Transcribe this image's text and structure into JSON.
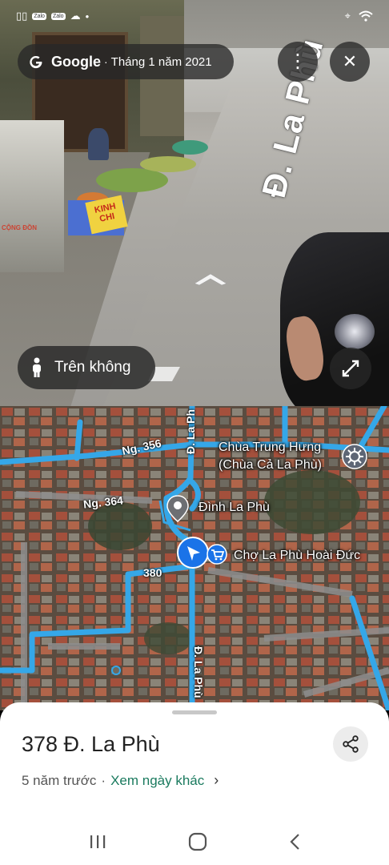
{
  "street_view": {
    "provider": "Google",
    "capture_date": "Tháng 1 năm 2021",
    "separator": "·",
    "road_name": "Đ. La Phù",
    "aerial_label": "Trên không",
    "stall_sign": "KINH CHI",
    "shop_sign": "CỘNG ĐỒN"
  },
  "status_bar": {
    "left_chips": [
      "Zalo",
      "Zalo"
    ]
  },
  "map": {
    "road_labels": {
      "ng356": "Ng. 356",
      "ng364": "Ng. 364",
      "road380": "380",
      "la_phu_top": "Đ. La Ph",
      "la_phu_bottom": "Đ. La Phù"
    },
    "places": {
      "temple_line1": "Chùa Trung Hưng",
      "temple_line2": "(Chùa Cả La Phù)",
      "communal_house": "Đình La Phù",
      "market": "Chợ La Phù Hoài Đức"
    }
  },
  "sheet": {
    "address": "378 Đ. La Phù",
    "age": "5 năm trước",
    "dot": "·",
    "other_dates_link": "Xem ngày khác"
  },
  "colors": {
    "route": "#35a7e8",
    "link": "#1a7a5e",
    "location": "#1a73e8"
  }
}
